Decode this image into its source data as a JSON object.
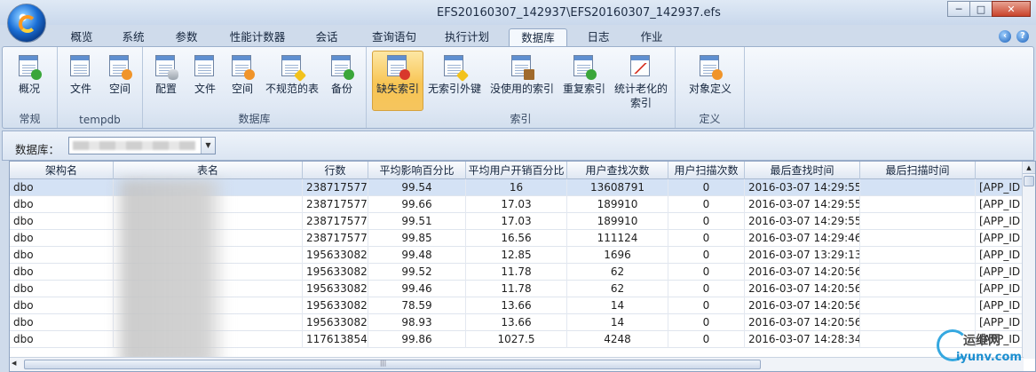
{
  "window": {
    "title": "EFS20160307_142937\\EFS20160307_142937.efs",
    "buttons": {
      "minimize": "─",
      "maximize": "□",
      "close": "✕"
    }
  },
  "tabs": [
    {
      "label": "概览"
    },
    {
      "label": "系统"
    },
    {
      "label": "参数"
    },
    {
      "label": "性能计数器"
    },
    {
      "label": "会话"
    },
    {
      "label": "查询语句"
    },
    {
      "label": "执行计划"
    },
    {
      "label": "数据库",
      "active": true
    },
    {
      "label": "日志"
    },
    {
      "label": "作业"
    }
  ],
  "ribbon": {
    "groups": [
      {
        "label": "常规",
        "buttons": [
          {
            "label": "概况",
            "icon": "overview-icon"
          }
        ]
      },
      {
        "label": "tempdb",
        "buttons": [
          {
            "label": "文件",
            "icon": "file-icon"
          },
          {
            "label": "空间",
            "icon": "space-icon"
          }
        ]
      },
      {
        "label": "数据库",
        "buttons": [
          {
            "label": "配置",
            "icon": "config-icon"
          },
          {
            "label": "文件",
            "icon": "file-icon"
          },
          {
            "label": "空间",
            "icon": "space-icon"
          },
          {
            "label": "不规范的表",
            "icon": "irregular-table-icon"
          },
          {
            "label": "备份",
            "icon": "backup-icon"
          }
        ]
      },
      {
        "label": "索引",
        "buttons": [
          {
            "label": "缺失索引",
            "icon": "missing-index-icon",
            "selected": true
          },
          {
            "label": "无索引外键",
            "icon": "warning-icon"
          },
          {
            "label": "没使用的索引",
            "icon": "unused-index-icon"
          },
          {
            "label": "重复索引",
            "icon": "duplicate-index-icon"
          },
          {
            "label": "统计老化的",
            "label2": "索引",
            "icon": "stats-chart-icon"
          }
        ]
      },
      {
        "label": "定义",
        "buttons": [
          {
            "label": "对象定义",
            "icon": "object-definition-icon"
          }
        ]
      }
    ]
  },
  "database_selector": {
    "label": "数据库："
  },
  "grid": {
    "columns": [
      "架构名",
      "表名",
      "行数",
      "平均影响百分比",
      "平均用户开销百分比",
      "用户查找次数",
      "用户扫描次数",
      "最后查找时间",
      "最后扫描时间",
      ""
    ],
    "rows": [
      [
        "dbo",
        "",
        "238717577",
        "99.54",
        "16",
        "13608791",
        "0",
        "2016-03-07 14:29:55",
        "",
        "[APP_ID"
      ],
      [
        "dbo",
        "",
        "238717577",
        "99.66",
        "17.03",
        "189910",
        "0",
        "2016-03-07 14:29:55",
        "",
        "[APP_ID"
      ],
      [
        "dbo",
        "",
        "238717577",
        "99.51",
        "17.03",
        "189910",
        "0",
        "2016-03-07 14:29:55",
        "",
        "[APP_ID"
      ],
      [
        "dbo",
        "",
        "238717577",
        "99.85",
        "16.56",
        "111124",
        "0",
        "2016-03-07 14:29:46",
        "",
        "[APP_ID"
      ],
      [
        "dbo",
        "",
        "195633082",
        "99.48",
        "12.85",
        "1696",
        "0",
        "2016-03-07 13:29:13",
        "",
        "[APP_ID"
      ],
      [
        "dbo",
        "",
        "195633082",
        "99.52",
        "11.78",
        "62",
        "0",
        "2016-03-07 14:20:56",
        "",
        "[APP_ID"
      ],
      [
        "dbo",
        "",
        "195633082",
        "99.46",
        "11.78",
        "62",
        "0",
        "2016-03-07 14:20:56",
        "",
        "[APP_ID"
      ],
      [
        "dbo",
        "",
        "195633082",
        "78.59",
        "13.66",
        "14",
        "0",
        "2016-03-07 14:20:56",
        "",
        "[APP_ID"
      ],
      [
        "dbo",
        "",
        "195633082",
        "98.93",
        "13.66",
        "14",
        "0",
        "2016-03-07 14:20:56",
        "",
        "[APP_ID"
      ],
      [
        "dbo",
        "",
        "117613854",
        "99.86",
        "1027.5",
        "4248",
        "0",
        "2016-03-07 14:28:34",
        "",
        "[APP_ID"
      ]
    ],
    "selected_row": 0
  },
  "watermark": {
    "top": "运维网",
    "bottom": "iyunv.com"
  }
}
